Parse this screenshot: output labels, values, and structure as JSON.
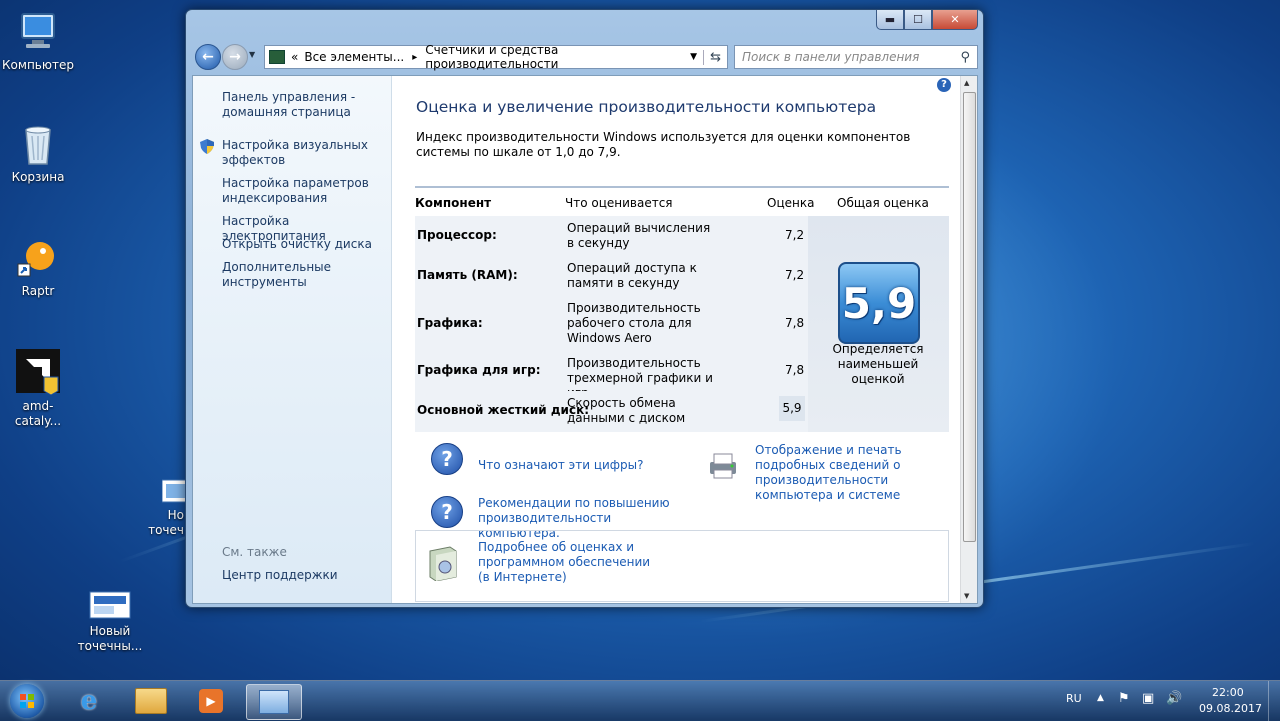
{
  "desktop": {
    "icons": [
      {
        "label": "Компьютер",
        "icon": "computer-icon"
      },
      {
        "label": "Корзина",
        "icon": "recycle-bin-icon"
      },
      {
        "label": "Raptr",
        "icon": "raptr-icon"
      },
      {
        "label": "amd-cataly...",
        "icon": "amd-catalyst-icon"
      },
      {
        "label_1": "Новый",
        "label_2": "точечны...",
        "icon": "bitmap-icon"
      },
      {
        "label_1": "Но",
        "label_2": "точеч",
        "icon": "bitmap-icon-partial"
      }
    ]
  },
  "window": {
    "caption_buttons": {
      "minimize": "▬",
      "maximize": "☐",
      "close": "✕"
    },
    "address": {
      "prefix": "«",
      "crumb_1": "Все элементы...",
      "separator": "▸",
      "crumb_2": "Счетчики и средства производительности"
    },
    "search": {
      "placeholder": "Поиск в панели управления"
    },
    "help_icon": "?",
    "sidebar": {
      "home_link": "Панель управления - домашняя страница",
      "links": [
        "Настройка визуальных эффектов",
        "Настройка параметров индексирования",
        "Настройка электропитания",
        "Открыть очистку диска",
        "Дополнительные инструменты"
      ],
      "see_also_title": "См. также",
      "see_also_links": [
        "Центр поддержки"
      ]
    },
    "main": {
      "title": "Оценка и увеличение производительности компьютера",
      "description": "Индекс производительности Windows используется для оценки компонентов системы по шкале от 1,0 до 7,9.",
      "table": {
        "headers": {
          "component": "Компонент",
          "what": "Что оценивается",
          "score": "Оценка",
          "overall": "Общая оценка"
        },
        "rows": [
          {
            "component": "Процессор:",
            "what": "Операций вычисления в секунду",
            "score": "7,2"
          },
          {
            "component": "Память (RAM):",
            "what": "Операций доступа к памяти в секунду",
            "score": "7,2"
          },
          {
            "component": "Графика:",
            "what": "Производительность рабочего стола для Windows Aero",
            "score": "7,8"
          },
          {
            "component": "Графика для игр:",
            "what": "Производительность трехмерной графики и игр",
            "score": "7,8"
          },
          {
            "component": "Основной жесткий диск:",
            "what": "Скорость обмена данными с диском",
            "score": "5,9"
          }
        ],
        "overall_score": "5,9",
        "overall_note": "Определяется наименьшей оценкой"
      },
      "links": {
        "what_numbers": "Что означают эти цифры?",
        "print_details": "Отображение и печать подробных сведений о производительности компьютера и системе",
        "recommendations": "Рекомендации по повышению производительности компьютера.",
        "more_info": "Подробнее об оценках и программном обеспечении (в Интернете)"
      }
    }
  },
  "taskbar": {
    "items": [
      "start-orb",
      "internet-explorer",
      "explorer",
      "media-player",
      "control-panel-active"
    ],
    "language": "RU",
    "time": "22:00",
    "date": "09.08.2017"
  },
  "colors": {
    "link": "#1b5bb3",
    "title": "#1e3a6e",
    "sidebar_text": "#1c3a63"
  }
}
